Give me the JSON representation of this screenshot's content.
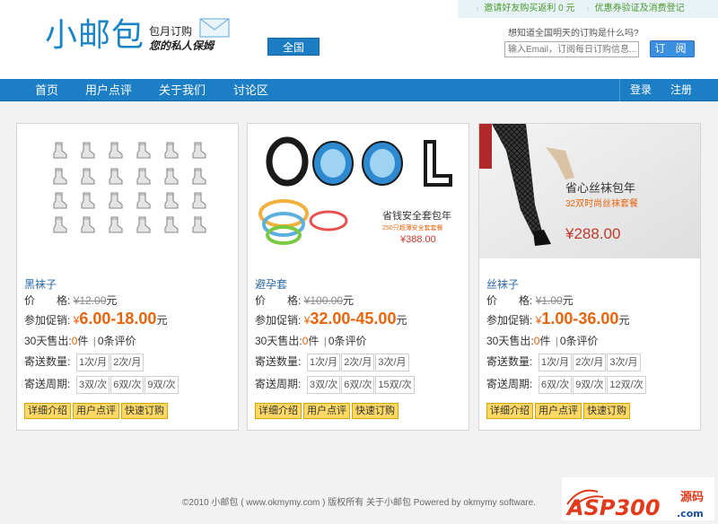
{
  "header": {
    "logo_text": "小邮包",
    "tagline_1": "包月订购",
    "tagline_2": "您的私人保姆",
    "city_button": "全国",
    "promo_links": [
      "邀请好友购买返利 0 元",
      "优惠券验证及消费登记"
    ],
    "subscribe_question": "想知道全国明天的订购是什么吗?",
    "subscribe_placeholder": "输入Email，订阅每日订购信息...",
    "subscribe_button": "订 阅"
  },
  "nav": {
    "items": [
      "首页",
      "用户点评",
      "关于我们",
      "讨论区"
    ],
    "login": "登录",
    "register": "注册"
  },
  "labels": {
    "price": "价　　格:",
    "promo": "参加促销:",
    "sold_prefix": "30天售出:",
    "sold_unit": "件",
    "reviews_suffix": "条评价",
    "qty": "寄送数量:",
    "cycle": "寄送周期:",
    "currency": "¥",
    "yuan": "元"
  },
  "products": [
    {
      "name": "黑袜子",
      "price": "¥12.00",
      "promo_range": "6.00-18.00",
      "sold": "0",
      "reviews": "0",
      "qty_options": [
        "1次/月",
        "2次/月"
      ],
      "cycle_options": [
        "3双/次",
        "6双/次",
        "9双/次"
      ],
      "actions": [
        "详细介绍",
        "用户点评",
        "快速订购"
      ]
    },
    {
      "name": "避孕套",
      "price": "¥100.00",
      "promo_range": "32.00-45.00",
      "sold": "0",
      "reviews": "0",
      "qty_options": [
        "1次/月",
        "2次/月",
        "3次/月"
      ],
      "cycle_options": [
        "3双/次",
        "6双/次",
        "15双/次"
      ],
      "actions": [
        "详细介绍",
        "用户点评",
        "快速订购"
      ],
      "image_text": {
        "big": "COOL",
        "caption": "省钱安全套包年",
        "sub": "250只超薄安全套套餐",
        "price": "¥388.00"
      }
    },
    {
      "name": "丝袜子",
      "price": "¥1.00",
      "promo_range": "1.00-36.00",
      "sold": "0",
      "reviews": "0",
      "qty_options": [
        "1次/月",
        "2次/月",
        "3次/月"
      ],
      "cycle_options": [
        "6双/次",
        "9双/次",
        "12双/次"
      ],
      "actions": [
        "详细介绍",
        "用户点评",
        "快速订购"
      ],
      "image_text": {
        "caption": "省心丝袜包年",
        "sub": "32双时尚丝袜套餐",
        "price": "¥288.00"
      }
    }
  ],
  "footer": "©2010 小邮包 ( www.okmymy.com ) 版权所有 关于小邮包  Powered by okmymy software.",
  "watermark": {
    "main": "ASP300",
    "side": "源码",
    "domain": ".com"
  },
  "colors": {
    "brand_blue": "#1c7ec5",
    "promo_orange": "#e8640c",
    "link_blue": "#2c68a8"
  }
}
